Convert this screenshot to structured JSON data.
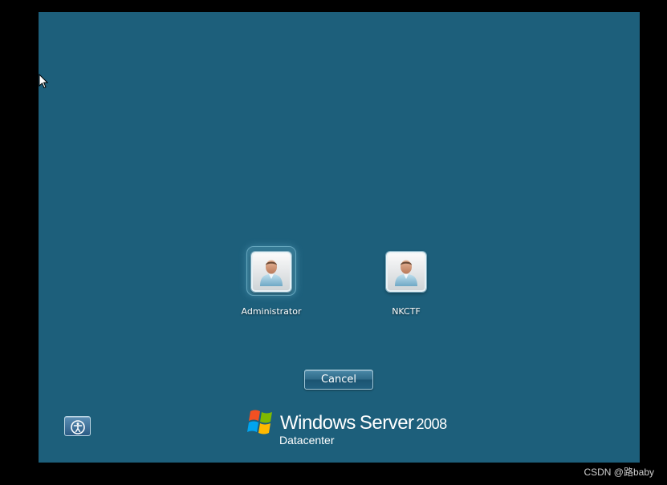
{
  "logon_screen": {
    "users": [
      {
        "name": "Administrator",
        "selected": true,
        "icon": "user-avatar-icon"
      },
      {
        "name": "NKCTF",
        "selected": false,
        "icon": "user-avatar-icon"
      }
    ],
    "cancel_label": "Cancel",
    "ease_of_access_icon": "ease-of-access-icon"
  },
  "branding": {
    "windows": "Windows",
    "server": "Server",
    "version": "2008",
    "edition": "Datacenter",
    "logo_icon": "windows-flag-icon"
  },
  "watermark": "CSDN @路baby",
  "colors": {
    "background": "#1d5f7b",
    "letterbox": "#000000",
    "text": "#ffffff"
  }
}
